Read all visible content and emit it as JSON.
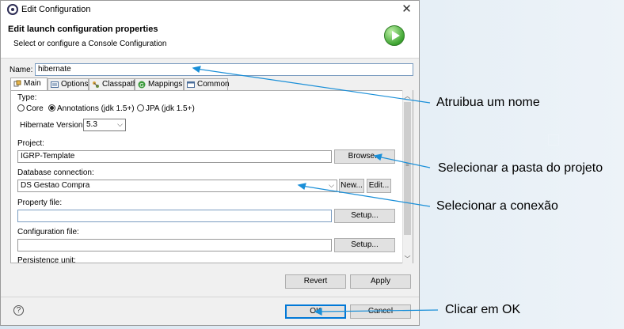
{
  "window": {
    "title": "Edit Configuration",
    "close_glyph": "✕",
    "app_icon": "eclipse-icon"
  },
  "header": {
    "title": "Edit launch configuration properties",
    "subtitle": "Select or configure a Console Configuration",
    "icon": "run-icon"
  },
  "name": {
    "label": "Name:",
    "value": "hibernate"
  },
  "tabs": [
    {
      "label": "Main",
      "active": true,
      "icon": "main-tab-icon"
    },
    {
      "label": "Options",
      "icon": "options-icon"
    },
    {
      "label": "Classpath",
      "icon": "classpath-icon"
    },
    {
      "label": "Mappings",
      "icon": "mappings-icon"
    },
    {
      "label": "Common",
      "icon": "common-icon"
    }
  ],
  "main": {
    "type_label": "Type:",
    "type_options": [
      {
        "label": "Core",
        "selected": false
      },
      {
        "label": "Annotations (jdk 1.5+)",
        "selected": true
      },
      {
        "label": "JPA (jdk 1.5+)",
        "selected": false
      }
    ],
    "hibernate_version_label": "Hibernate Version:",
    "hibernate_version_value": "5.3",
    "project_label": "Project:",
    "project_value": "IGRP-Template",
    "browse_label": "Browse...",
    "db_connection_label": "Database connection:",
    "db_connection_value": "DS Gestao Compra",
    "new_label": "New...",
    "edit_label": "Edit...",
    "property_file_label": "Property file:",
    "property_file_value": "",
    "configuration_file_label": "Configuration file:",
    "configuration_file_value": "",
    "setup_label": "Setup...",
    "persistence_unit_label": "Persistence unit:"
  },
  "actions": {
    "revert": "Revert",
    "apply": "Apply",
    "ok": "OK",
    "cancel": "Cancel",
    "help": "?"
  },
  "annotations": [
    "Atruibua um nome",
    "Selecionar a pasta do projeto",
    "Selecionar a conexão",
    "Clicar em OK"
  ],
  "colors": {
    "accent": "#0078d7",
    "annotation_line": "#1a8fd8",
    "run_icon": "#3fa532"
  }
}
